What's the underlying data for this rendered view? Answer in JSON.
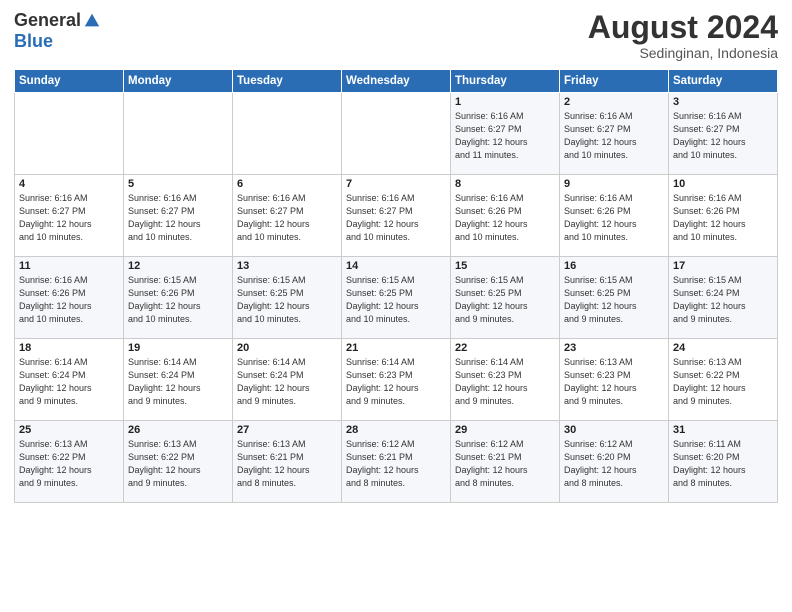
{
  "logo": {
    "general": "General",
    "blue": "Blue"
  },
  "header": {
    "month_year": "August 2024",
    "location": "Sedinginan, Indonesia"
  },
  "days_of_week": [
    "Sunday",
    "Monday",
    "Tuesday",
    "Wednesday",
    "Thursday",
    "Friday",
    "Saturday"
  ],
  "weeks": [
    [
      {
        "day": "",
        "info": ""
      },
      {
        "day": "",
        "info": ""
      },
      {
        "day": "",
        "info": ""
      },
      {
        "day": "",
        "info": ""
      },
      {
        "day": "1",
        "info": "Sunrise: 6:16 AM\nSunset: 6:27 PM\nDaylight: 12 hours\nand 11 minutes."
      },
      {
        "day": "2",
        "info": "Sunrise: 6:16 AM\nSunset: 6:27 PM\nDaylight: 12 hours\nand 10 minutes."
      },
      {
        "day": "3",
        "info": "Sunrise: 6:16 AM\nSunset: 6:27 PM\nDaylight: 12 hours\nand 10 minutes."
      }
    ],
    [
      {
        "day": "4",
        "info": "Sunrise: 6:16 AM\nSunset: 6:27 PM\nDaylight: 12 hours\nand 10 minutes."
      },
      {
        "day": "5",
        "info": "Sunrise: 6:16 AM\nSunset: 6:27 PM\nDaylight: 12 hours\nand 10 minutes."
      },
      {
        "day": "6",
        "info": "Sunrise: 6:16 AM\nSunset: 6:27 PM\nDaylight: 12 hours\nand 10 minutes."
      },
      {
        "day": "7",
        "info": "Sunrise: 6:16 AM\nSunset: 6:27 PM\nDaylight: 12 hours\nand 10 minutes."
      },
      {
        "day": "8",
        "info": "Sunrise: 6:16 AM\nSunset: 6:26 PM\nDaylight: 12 hours\nand 10 minutes."
      },
      {
        "day": "9",
        "info": "Sunrise: 6:16 AM\nSunset: 6:26 PM\nDaylight: 12 hours\nand 10 minutes."
      },
      {
        "day": "10",
        "info": "Sunrise: 6:16 AM\nSunset: 6:26 PM\nDaylight: 12 hours\nand 10 minutes."
      }
    ],
    [
      {
        "day": "11",
        "info": "Sunrise: 6:16 AM\nSunset: 6:26 PM\nDaylight: 12 hours\nand 10 minutes."
      },
      {
        "day": "12",
        "info": "Sunrise: 6:15 AM\nSunset: 6:26 PM\nDaylight: 12 hours\nand 10 minutes."
      },
      {
        "day": "13",
        "info": "Sunrise: 6:15 AM\nSunset: 6:25 PM\nDaylight: 12 hours\nand 10 minutes."
      },
      {
        "day": "14",
        "info": "Sunrise: 6:15 AM\nSunset: 6:25 PM\nDaylight: 12 hours\nand 10 minutes."
      },
      {
        "day": "15",
        "info": "Sunrise: 6:15 AM\nSunset: 6:25 PM\nDaylight: 12 hours\nand 9 minutes."
      },
      {
        "day": "16",
        "info": "Sunrise: 6:15 AM\nSunset: 6:25 PM\nDaylight: 12 hours\nand 9 minutes."
      },
      {
        "day": "17",
        "info": "Sunrise: 6:15 AM\nSunset: 6:24 PM\nDaylight: 12 hours\nand 9 minutes."
      }
    ],
    [
      {
        "day": "18",
        "info": "Sunrise: 6:14 AM\nSunset: 6:24 PM\nDaylight: 12 hours\nand 9 minutes."
      },
      {
        "day": "19",
        "info": "Sunrise: 6:14 AM\nSunset: 6:24 PM\nDaylight: 12 hours\nand 9 minutes."
      },
      {
        "day": "20",
        "info": "Sunrise: 6:14 AM\nSunset: 6:24 PM\nDaylight: 12 hours\nand 9 minutes."
      },
      {
        "day": "21",
        "info": "Sunrise: 6:14 AM\nSunset: 6:23 PM\nDaylight: 12 hours\nand 9 minutes."
      },
      {
        "day": "22",
        "info": "Sunrise: 6:14 AM\nSunset: 6:23 PM\nDaylight: 12 hours\nand 9 minutes."
      },
      {
        "day": "23",
        "info": "Sunrise: 6:13 AM\nSunset: 6:23 PM\nDaylight: 12 hours\nand 9 minutes."
      },
      {
        "day": "24",
        "info": "Sunrise: 6:13 AM\nSunset: 6:22 PM\nDaylight: 12 hours\nand 9 minutes."
      }
    ],
    [
      {
        "day": "25",
        "info": "Sunrise: 6:13 AM\nSunset: 6:22 PM\nDaylight: 12 hours\nand 9 minutes."
      },
      {
        "day": "26",
        "info": "Sunrise: 6:13 AM\nSunset: 6:22 PM\nDaylight: 12 hours\nand 9 minutes."
      },
      {
        "day": "27",
        "info": "Sunrise: 6:13 AM\nSunset: 6:21 PM\nDaylight: 12 hours\nand 8 minutes."
      },
      {
        "day": "28",
        "info": "Sunrise: 6:12 AM\nSunset: 6:21 PM\nDaylight: 12 hours\nand 8 minutes."
      },
      {
        "day": "29",
        "info": "Sunrise: 6:12 AM\nSunset: 6:21 PM\nDaylight: 12 hours\nand 8 minutes."
      },
      {
        "day": "30",
        "info": "Sunrise: 6:12 AM\nSunset: 6:20 PM\nDaylight: 12 hours\nand 8 minutes."
      },
      {
        "day": "31",
        "info": "Sunrise: 6:11 AM\nSunset: 6:20 PM\nDaylight: 12 hours\nand 8 minutes."
      }
    ]
  ]
}
